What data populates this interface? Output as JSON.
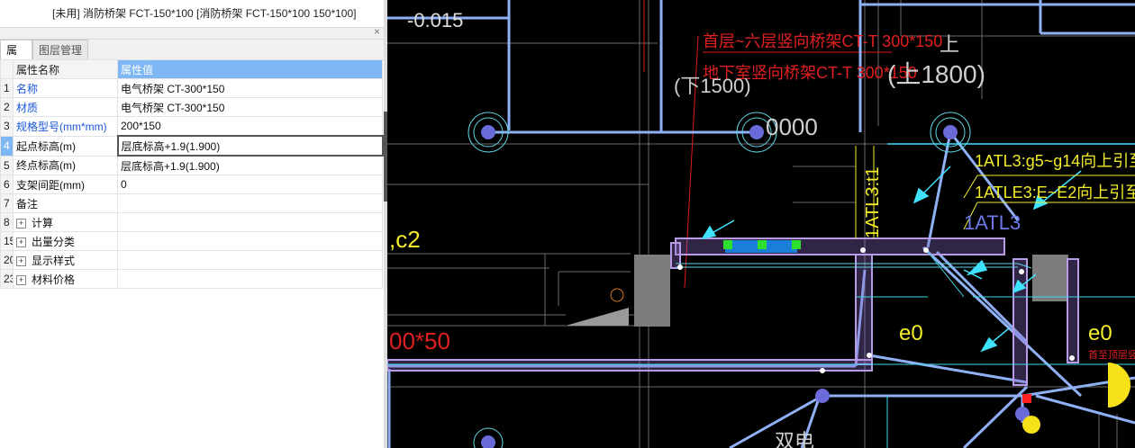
{
  "top_item": "[未用] 消防桥架 FCT-150*100 [消防桥架 FCT-150*100 150*100]",
  "tabs": [
    "属性",
    "图层管理"
  ],
  "close_icon": "×",
  "table": {
    "headers": [
      "属性名称",
      "属性值"
    ],
    "rows": [
      {
        "idx": "1",
        "name": "名称",
        "value": "电气桥架 CT-300*150"
      },
      {
        "idx": "2",
        "name": "材质",
        "value": "电气桥架 CT-300*150"
      },
      {
        "idx": "3",
        "name": "规格型号(mm*mm)",
        "value": "200*150"
      },
      {
        "idx": "4",
        "name": "起点标高(m)",
        "value": "层底标高+1.9(1.900)"
      },
      {
        "idx": "5",
        "name": "终点标高(m)",
        "value": "层底标高+1.9(1.900)"
      },
      {
        "idx": "6",
        "name": "支架间距(mm)",
        "value": "0"
      },
      {
        "idx": "7",
        "name": "备注",
        "value": ""
      },
      {
        "idx": "8",
        "name": "计算",
        "value": ""
      },
      {
        "idx": "15",
        "name": "出量分类",
        "value": ""
      },
      {
        "idx": "20",
        "name": "显示样式",
        "value": ""
      },
      {
        "idx": "23",
        "name": "材料价格",
        "value": ""
      }
    ]
  },
  "cad": {
    "labels": {
      "elev": "-0.015",
      "tray1": "首层~六层竖向桥架CT-T 300*150",
      "tray2": "地下室竖向桥架CT-T 300*150",
      "paren1": "(下1500)",
      "paren2": "(上1800)",
      "shang": "上",
      "num0000": "0000",
      "atl1": "1ATL3:g5~g14向上引至~",
      "atl2": "1ATLE3:E~E2向上引至~",
      "atl3": "1ATL3",
      "atlv": "1ATL3:t1",
      "c2": ",c2",
      "size": "00*50",
      "e0a": "e0",
      "e0b": "e0",
      "vert": "首至顶层竖向桥",
      "bottom": "双电"
    }
  }
}
